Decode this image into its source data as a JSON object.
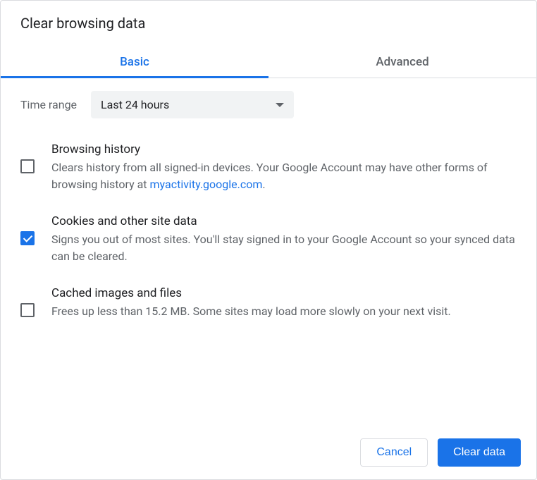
{
  "title": "Clear browsing data",
  "tabs": {
    "basic": "Basic",
    "advanced": "Advanced"
  },
  "timeRange": {
    "label": "Time range",
    "selected": "Last 24 hours"
  },
  "options": [
    {
      "title": "Browsing history",
      "desc_pre": "Clears history from all signed-in devices. Your Google Account may have other forms of browsing history at ",
      "link": "myactivity.google.com",
      "desc_post": ".",
      "checked": false
    },
    {
      "title": "Cookies and other site data",
      "desc": "Signs you out of most sites. You'll stay signed in to your Google Account so your synced data can be cleared.",
      "checked": true
    },
    {
      "title": "Cached images and files",
      "desc": "Frees up less than 15.2 MB. Some sites may load more slowly on your next visit.",
      "checked": false
    }
  ],
  "buttons": {
    "cancel": "Cancel",
    "clear": "Clear data"
  }
}
